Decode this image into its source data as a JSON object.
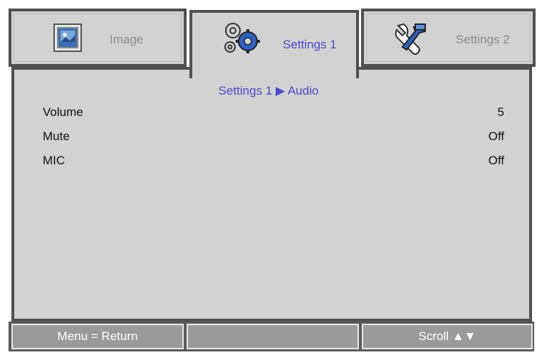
{
  "tabs": [
    {
      "label": "Image",
      "icon": "image-icon"
    },
    {
      "label": "Settings 1",
      "icon": "gears-icon"
    },
    {
      "label": "Settings 2",
      "icon": "tools-icon"
    }
  ],
  "breadcrumb": {
    "text": "Settings 1 ▶ Audio"
  },
  "rows": [
    {
      "label": "Volume",
      "value": "5"
    },
    {
      "label": "Mute",
      "value": "Off"
    },
    {
      "label": "MIC",
      "value": "Off"
    }
  ],
  "bottom": {
    "left": "Menu = Return",
    "middle": "",
    "right": "Scroll ▲▼"
  },
  "colors": {
    "active_tab_text": "#4a4acb",
    "panel_bg": "#d2d2d2",
    "border": "#505050",
    "bar_bg": "#9a9a9a"
  }
}
